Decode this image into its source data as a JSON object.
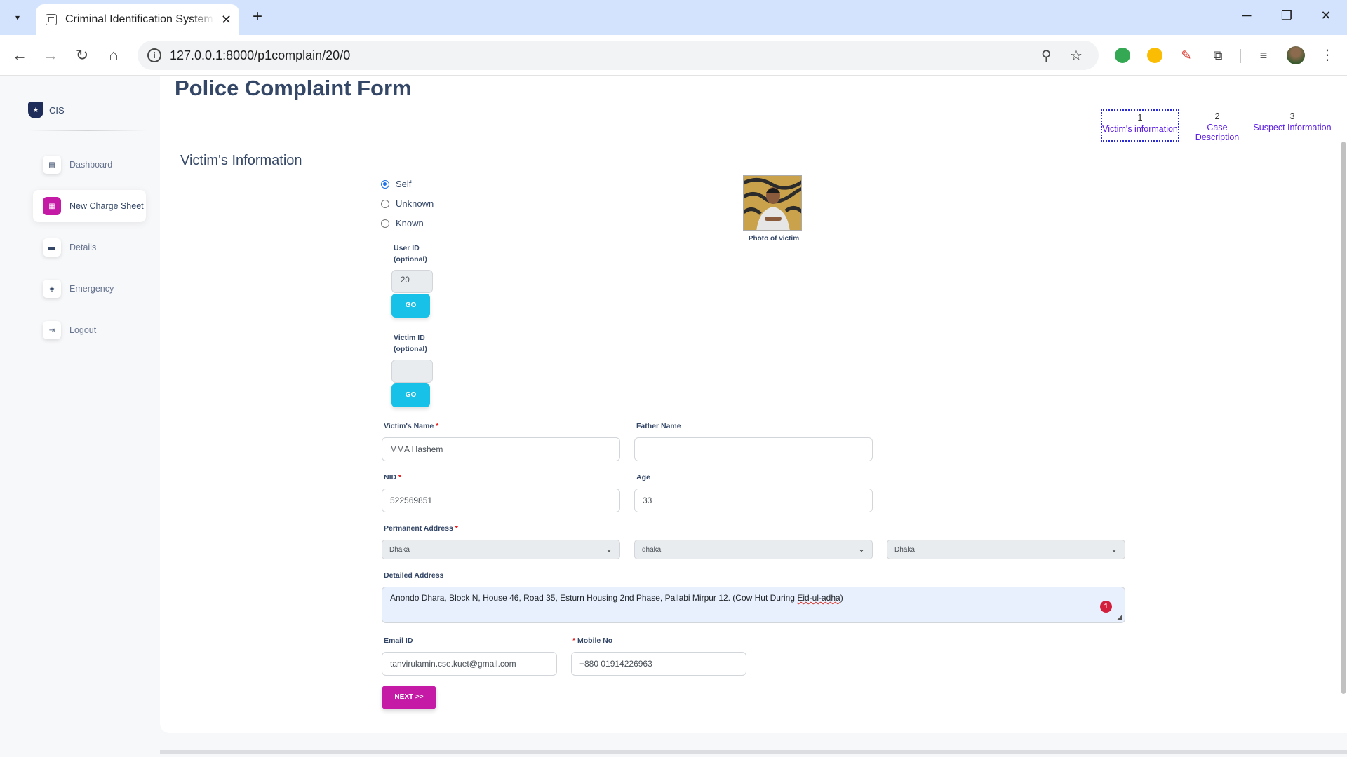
{
  "browser": {
    "tab_title": "Criminal Identification System -",
    "tab_close": "✕",
    "new_tab": "+",
    "url": "127.0.0.1:8000/p1complain/20/0"
  },
  "sidebar": {
    "brand": "CIS",
    "items": [
      {
        "label": "Dashboard",
        "icon": "shop-icon"
      },
      {
        "label": "New Charge Sheet",
        "icon": "office-icon",
        "active": true
      },
      {
        "label": "Details",
        "icon": "credit-card-icon"
      },
      {
        "label": "Emergency",
        "icon": "box-icon"
      },
      {
        "label": "Logout",
        "icon": "logout-icon"
      }
    ]
  },
  "form": {
    "title": "Police Complaint Form",
    "steps": [
      {
        "num": "1",
        "label": "Victim's information"
      },
      {
        "num": "2",
        "label": "Case Description"
      },
      {
        "num": "3",
        "label": "Suspect Information"
      }
    ],
    "section_title": "Victim's Information",
    "radio_options": [
      "Self",
      "Unknown",
      "Known"
    ],
    "selected_radio": "Self",
    "user_id_label_1": "User ID",
    "user_id_label_2": "(optional)",
    "user_id_value": "20",
    "victim_id_label_1": "Victim ID",
    "victim_id_label_2": "(optional)",
    "victim_id_value": "",
    "go_label": "GO",
    "photo_caption": "Photo of victim",
    "victim_name_label": "Victim's Name",
    "victim_name_value": "MMA Hashem",
    "father_name_label": "Father Name",
    "father_name_value": "",
    "nid_label": "NID",
    "nid_value": "522569851",
    "age_label": "Age",
    "age_value": "33",
    "permanent_address_label": "Permanent Address",
    "division": "Dhaka",
    "district": "dhaka",
    "upazila": "Dhaka",
    "detailed_address_label": "Detailed Address",
    "detailed_address_value_main": "Anondo Dhara, Block N, House 46, Road 35, Esturn Housing 2nd Phase, Pallabi Mirpur 12. (Cow Hut During ",
    "detailed_address_value_flag": "Eid-ul-adha",
    "detailed_address_value_end": ")",
    "grammar_badge": "1",
    "email_label": "Email ID",
    "email_value": "tanvirulamin.cse.kuet@gmail.com",
    "mobile_label": "Mobile No",
    "mobile_value": "+880  01914226963",
    "required_mark": "*",
    "next_label": "NEXT >>"
  },
  "colors": {
    "primary": "#c51aa6",
    "info": "#17c1e8",
    "heading": "#344767",
    "step_link": "#5a1ce6"
  }
}
